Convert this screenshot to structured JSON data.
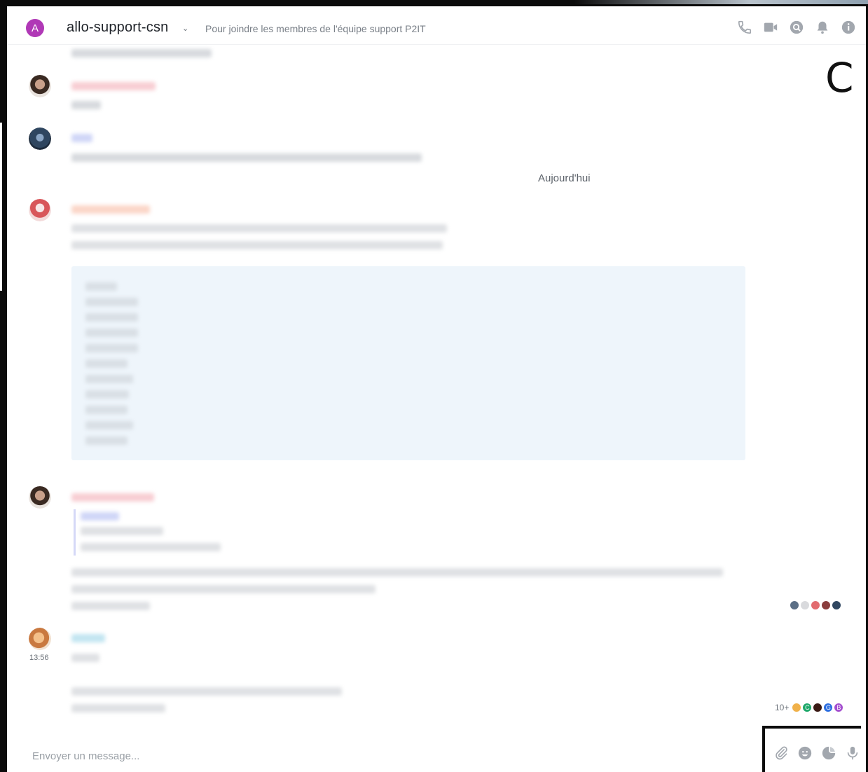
{
  "room": {
    "avatar_letter": "A",
    "name": "allo-support-csn",
    "topic": "Pour joindre les membres de l'équipe support P2IT"
  },
  "header_icons": [
    "phone-icon",
    "video-camera-icon",
    "discussion-icon",
    "bell-icon",
    "info-icon"
  ],
  "overlay_letter": "C",
  "day_divider": "Aujourd'hui",
  "last_message_time": "13:56",
  "reactions_last": {
    "count": "10+",
    "letters": [
      "C",
      "G",
      "B"
    ]
  },
  "composer": {
    "placeholder": "Envoyer un message...",
    "tools": [
      "paperclip-icon",
      "emoji-icon",
      "sticker-icon",
      "microphone-icon"
    ]
  },
  "colors": {
    "room_avatar": "#b038b6",
    "icon_gray": "#a2a7ae",
    "code_block_bg": "#eef5fb"
  }
}
